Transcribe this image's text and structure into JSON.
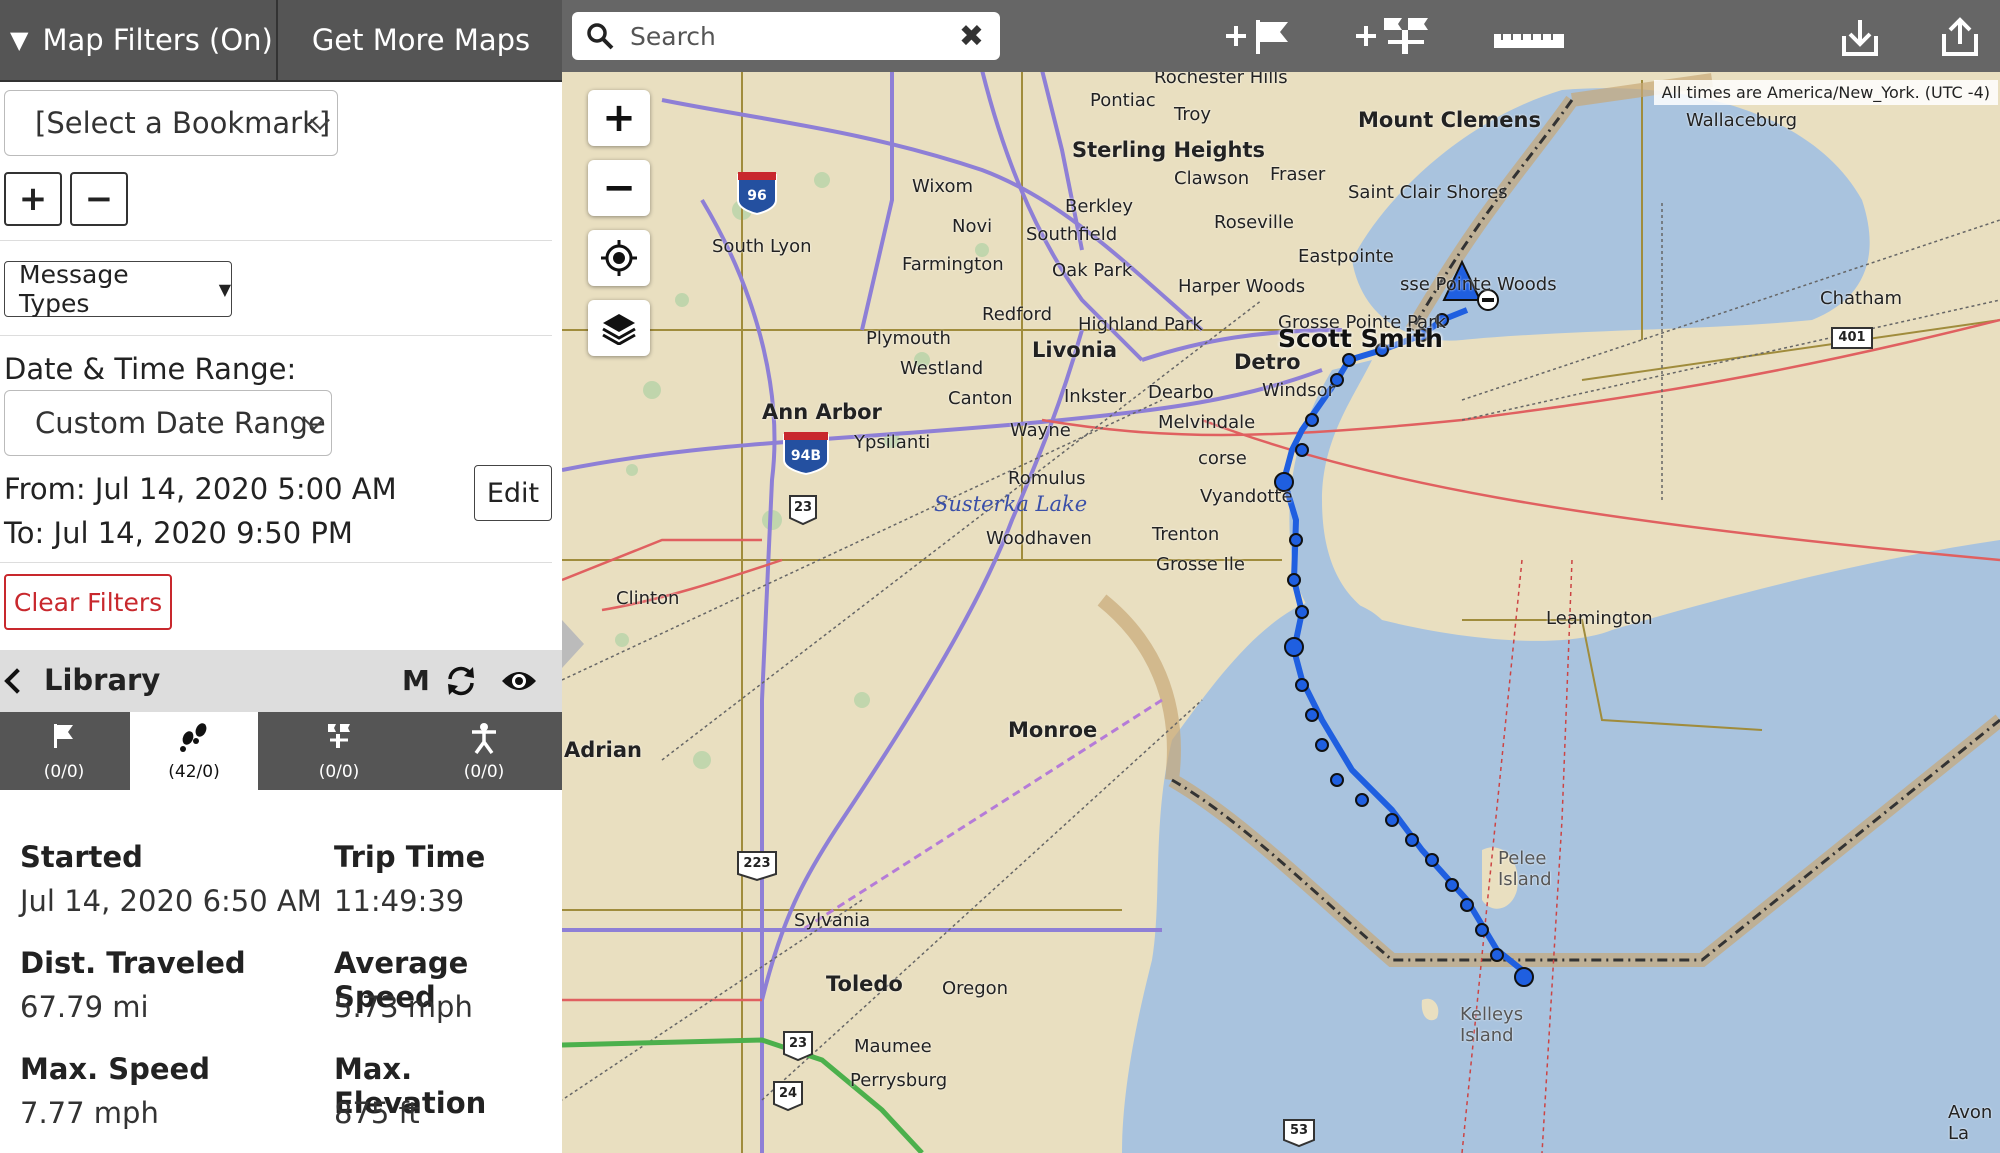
{
  "sidebar": {
    "filters_label": "Map Filters (On)",
    "more_maps_label": "Get More Maps",
    "bookmark_select": "[Select a Bookmark]",
    "add_symbol": "+",
    "remove_symbol": "−",
    "message_types_label": "Message Types",
    "date_range_heading": "Date & Time Range:",
    "date_range_select": "Custom Date Range",
    "from_text": "From: Jul 14, 2020 5:00 AM",
    "to_text": "To: Jul 14, 2020 9:50 PM",
    "edit_label": "Edit",
    "clear_filters_label": "Clear Filters"
  },
  "library": {
    "title": "Library",
    "m_label": "M",
    "tabs": [
      {
        "icon": "flag-icon",
        "count": "(0/0)"
      },
      {
        "icon": "footsteps-icon",
        "count": "(42/0)"
      },
      {
        "icon": "waypoints-icon",
        "count": "(0/0)"
      },
      {
        "icon": "person-icon",
        "count": "(0/0)"
      }
    ]
  },
  "stats": [
    {
      "label": "Started",
      "value": "Jul 14, 2020 6:50 AM"
    },
    {
      "label": "Trip Time",
      "value": "11:49:39"
    },
    {
      "label": "Dist. Traveled",
      "value": "67.79 mi"
    },
    {
      "label": "Average Speed",
      "value": "5.73 mph"
    },
    {
      "label": "Max. Speed",
      "value": "7.77 mph"
    },
    {
      "label": "Max. Elevation",
      "value": "875 ft"
    }
  ],
  "map": {
    "search_placeholder": "Search",
    "timezone_note": "All times are America/New_York. (UTC -4)",
    "person_label": "Scott Smith",
    "track_color": "#1f5fe0",
    "water_color": "#a9c3de",
    "cities": {
      "rochester_hills": "Rochester Hills",
      "pontiac": "Pontiac",
      "troy": "Troy",
      "mount_clemens": "Mount Clemens",
      "sterling_heights": "Sterling Heights",
      "wixom": "Wixom",
      "clawson": "Clawson",
      "fraser": "Fraser",
      "saint_clair_shores": "Saint Clair Shores",
      "berkley": "Berkley",
      "novi": "Novi",
      "southfield": "Southfield",
      "roseville": "Roseville",
      "south_lyon": "South Lyon",
      "farmington": "Farmington",
      "oak_park": "Oak Park",
      "eastpointe": "Eastpointe",
      "harper_woods": "Harper Woods",
      "grosse_pointe_woods": "sse Pointe Woods",
      "redford": "Redford",
      "highland_park": "Highland Park",
      "grosse_pointe_park": "Grosse Pointe Park",
      "plymouth": "Plymouth",
      "livonia": "Livonia",
      "westland": "Westland",
      "detroit": "Detro",
      "canton": "Canton",
      "inkster": "Inkster",
      "dearborn": "Dearbo",
      "windsor": "Windsor",
      "ann_arbor": "Ann Arbor",
      "melvindale": "Melvindale",
      "ypsilanti": "Ypsilanti",
      "wayne": "Wayne",
      "ecorse": "corse",
      "romulus": "Romulus",
      "wyandotte": "Vyandotte",
      "susterka_lake": "Susterka Lake",
      "trenton": "Trenton",
      "woodhaven": "Woodhaven",
      "grosse_ile": "Grosse Ile",
      "clinton": "Clinton",
      "leamington": "Leamington",
      "chatham": "Chatham",
      "wallaceburg": "Wallaceburg",
      "monroe": "Monroe",
      "adrian": "Adrian",
      "sylvania": "Sylvania",
      "toledo": "Toledo",
      "oregon": "Oregon",
      "maumee": "Maumee",
      "perrysburg": "Perrysburg",
      "pelee_island": "Pelee Island",
      "kelleys_island": "Kelleys Island",
      "avon_lake": "Avon La"
    },
    "shields": [
      "96",
      "94B",
      "23",
      "223",
      "23",
      "24",
      "53",
      "401"
    ]
  }
}
